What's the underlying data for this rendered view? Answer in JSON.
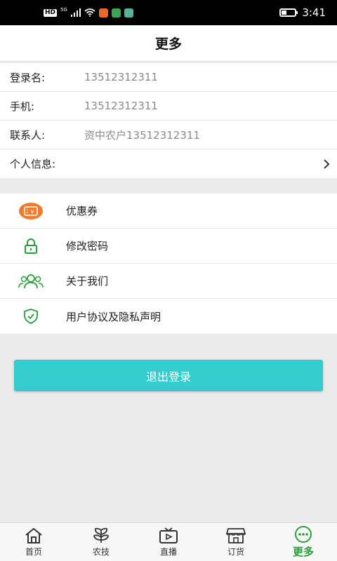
{
  "status_bar": {
    "hd": "HD",
    "network": "5G",
    "time": "3:41",
    "battery_level": 0.35,
    "icons": [
      "signal-icon",
      "wifi-icon",
      "app-notification-icon",
      "app-notification-icon",
      "app-notification-icon",
      "battery-icon"
    ]
  },
  "header": {
    "title": "更多"
  },
  "info": {
    "rows": [
      {
        "label": "登录名:",
        "value": "13512312311"
      },
      {
        "label": "手机:",
        "value": "13512312311"
      },
      {
        "label": "联系人:",
        "value": "资中农户13512312311"
      },
      {
        "label": "个人信息:",
        "value": ""
      }
    ]
  },
  "menu": {
    "items": [
      {
        "label": "优惠券",
        "icon": "coupon-icon"
      },
      {
        "label": "修改密码",
        "icon": "lock-icon"
      },
      {
        "label": "关于我们",
        "icon": "users-icon"
      },
      {
        "label": "用户协议及隐私声明",
        "icon": "shield-check-icon"
      }
    ]
  },
  "logout": {
    "label": "退出登录"
  },
  "bottom_nav": {
    "items": [
      {
        "label": "首页",
        "icon": "home-icon",
        "active": false
      },
      {
        "label": "农技",
        "icon": "plant-icon",
        "active": false
      },
      {
        "label": "直播",
        "icon": "tv-icon",
        "active": false
      },
      {
        "label": "订货",
        "icon": "store-icon",
        "active": false
      },
      {
        "label": "更多",
        "icon": "more-icon",
        "active": true
      }
    ]
  },
  "colors": {
    "accent": "#34cccd",
    "active_tab": "#2a9d3d",
    "icon_green": "#2a9d3d",
    "coupon_orange": "#f07a2e"
  }
}
